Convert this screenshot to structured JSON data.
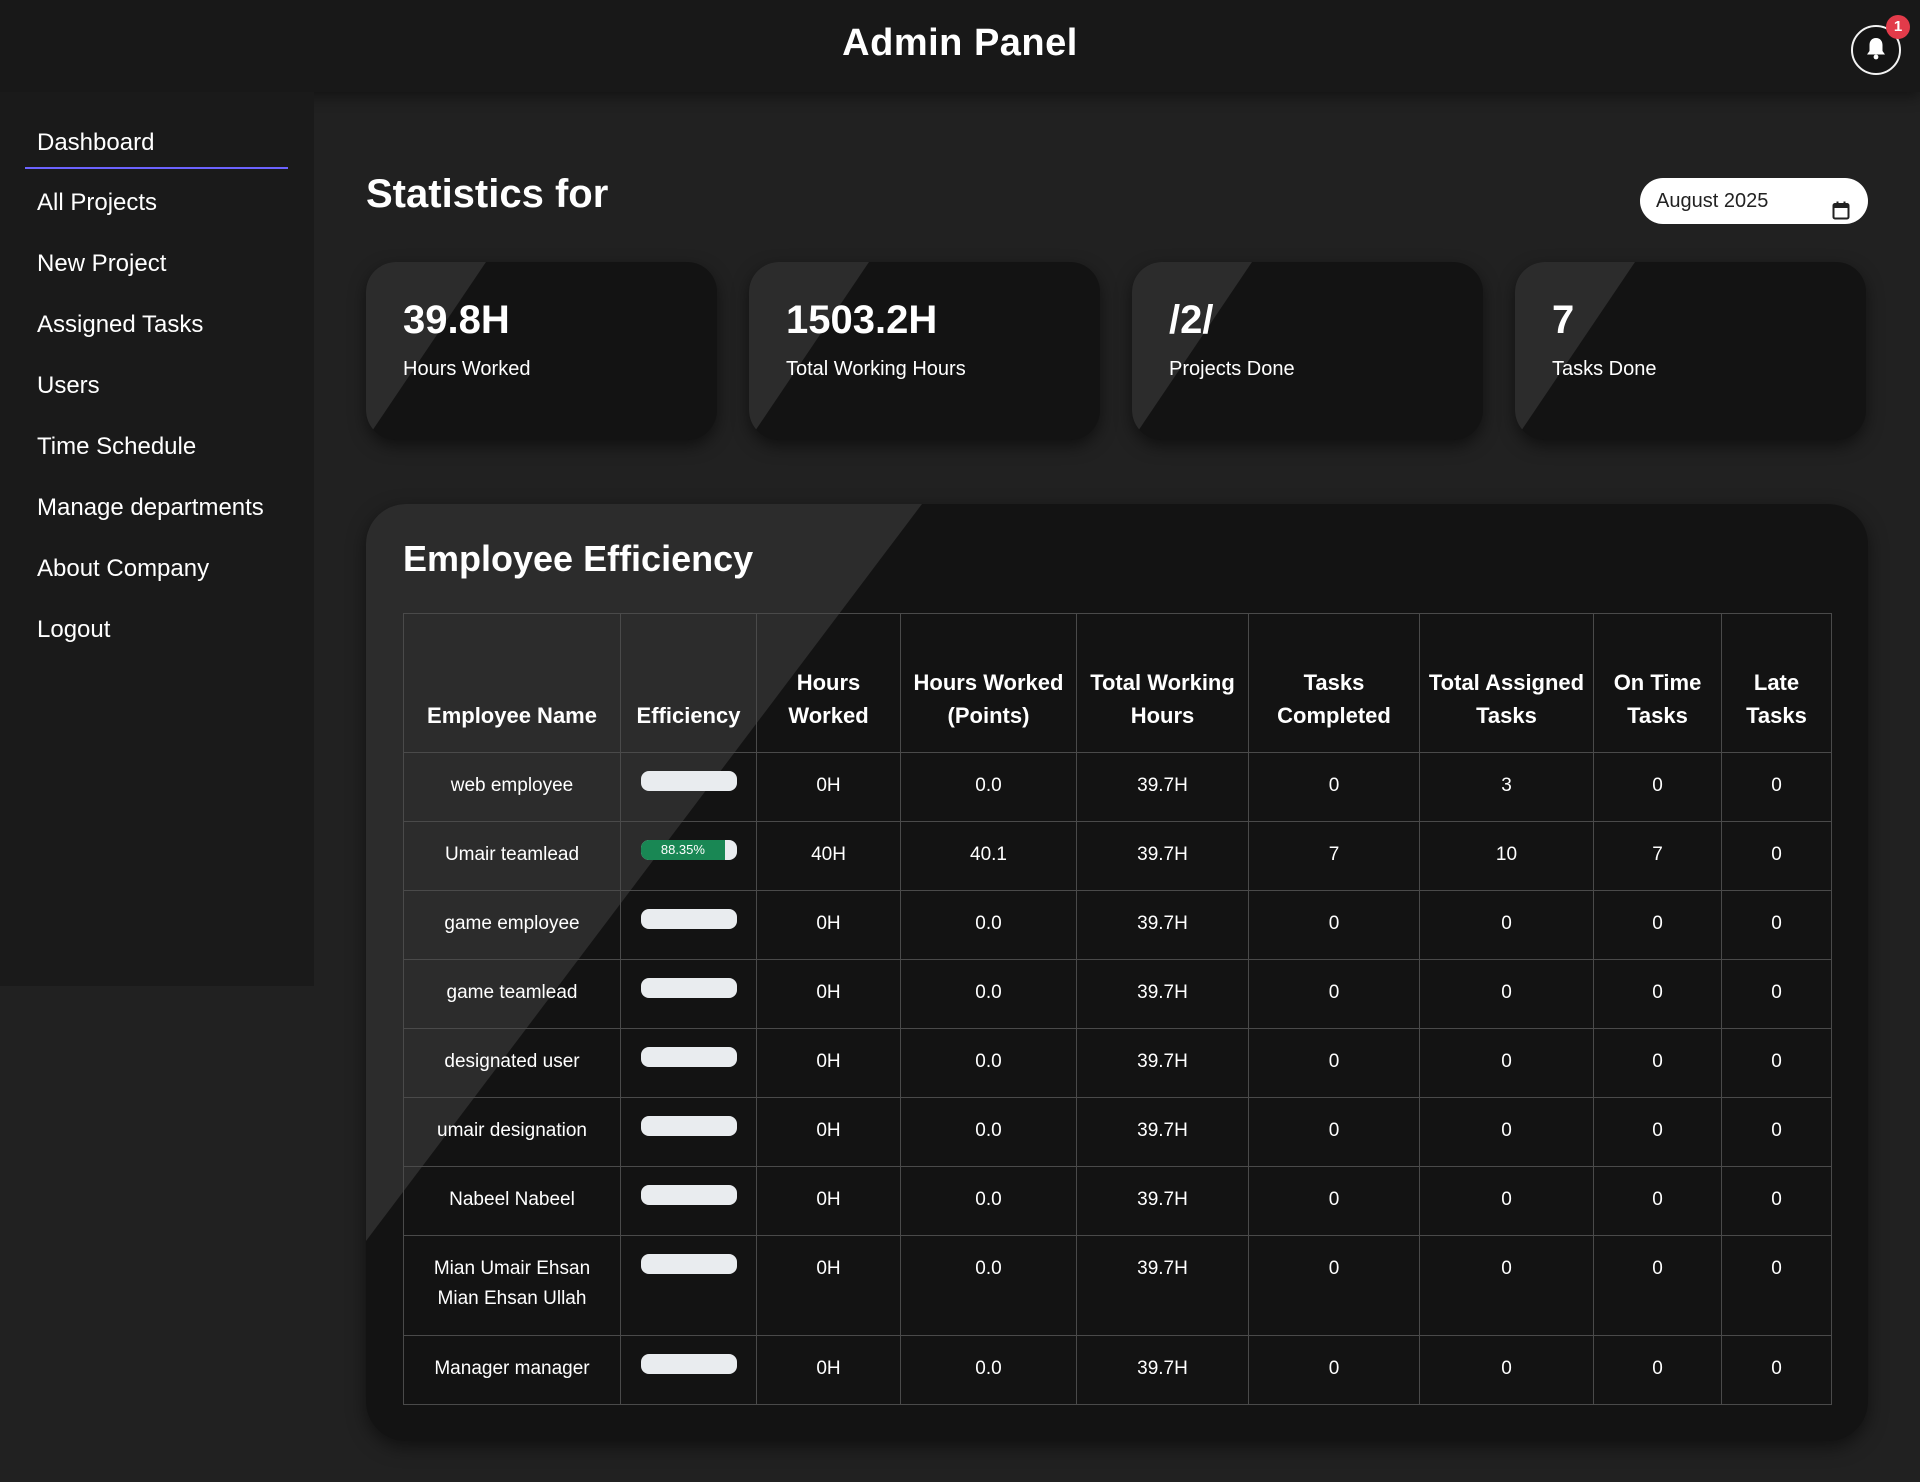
{
  "header": {
    "title": "Admin Panel",
    "notification_count": "1",
    "bell_icon": "bell-icon"
  },
  "sidebar": {
    "items": [
      {
        "label": "Dashboard",
        "active": true
      },
      {
        "label": "All Projects"
      },
      {
        "label": "New Project"
      },
      {
        "label": "Assigned Tasks"
      },
      {
        "label": "Users"
      },
      {
        "label": "Time Schedule"
      },
      {
        "label": "Manage departments"
      },
      {
        "label": "About Company"
      },
      {
        "label": "Logout"
      }
    ],
    "active_underline_color": "#6c63ff"
  },
  "main": {
    "title": "Statistics for",
    "month_value": "August 2025",
    "calendar_icon": "calendar-icon"
  },
  "stats": [
    {
      "value": "39.8H",
      "label": "Hours Worked"
    },
    {
      "value": "1503.2H",
      "label": "Total Working Hours"
    },
    {
      "value": "/2/",
      "label": "Projects Done"
    },
    {
      "value": "7",
      "label": "Tasks Done"
    }
  ],
  "efficiency": {
    "title": "Employee Efficiency",
    "columns": [
      "Employee Name",
      "Efficiency",
      "Hours Worked",
      "Hours Worked (Points)",
      "Total Working Hours",
      "Tasks Completed",
      "Total Assigned Tasks",
      "On Time Tasks",
      "Late Tasks"
    ],
    "bar_color": "#198754",
    "rows": [
      {
        "name": "web employee",
        "efficiency": 0,
        "efficiency_label": "",
        "hours": "0H",
        "points": "0.0",
        "total": "39.7H",
        "completed": "0",
        "assigned": "3",
        "ontime": "0",
        "late": "0"
      },
      {
        "name": "Umair teamlead",
        "efficiency": 88.35,
        "efficiency_label": "88.35%",
        "hours": "40H",
        "points": "40.1",
        "total": "39.7H",
        "completed": "7",
        "assigned": "10",
        "ontime": "7",
        "late": "0"
      },
      {
        "name": "game employee",
        "efficiency": 0,
        "efficiency_label": "",
        "hours": "0H",
        "points": "0.0",
        "total": "39.7H",
        "completed": "0",
        "assigned": "0",
        "ontime": "0",
        "late": "0"
      },
      {
        "name": "game teamlead",
        "efficiency": 0,
        "efficiency_label": "",
        "hours": "0H",
        "points": "0.0",
        "total": "39.7H",
        "completed": "0",
        "assigned": "0",
        "ontime": "0",
        "late": "0"
      },
      {
        "name": "designated user",
        "efficiency": 0,
        "efficiency_label": "",
        "hours": "0H",
        "points": "0.0",
        "total": "39.7H",
        "completed": "0",
        "assigned": "0",
        "ontime": "0",
        "late": "0"
      },
      {
        "name": "umair designation",
        "efficiency": 0,
        "efficiency_label": "",
        "hours": "0H",
        "points": "0.0",
        "total": "39.7H",
        "completed": "0",
        "assigned": "0",
        "ontime": "0",
        "late": "0"
      },
      {
        "name": "Nabeel Nabeel",
        "efficiency": 0,
        "efficiency_label": "",
        "hours": "0H",
        "points": "0.0",
        "total": "39.7H",
        "completed": "0",
        "assigned": "0",
        "ontime": "0",
        "late": "0"
      },
      {
        "name": "Mian Umair Ehsan Mian Ehsan Ullah",
        "efficiency": 0,
        "efficiency_label": "",
        "hours": "0H",
        "points": "0.0",
        "total": "39.7H",
        "completed": "0",
        "assigned": "0",
        "ontime": "0",
        "late": "0"
      },
      {
        "name": "Manager manager",
        "efficiency": 0,
        "efficiency_label": "",
        "hours": "0H",
        "points": "0.0",
        "total": "39.7H",
        "completed": "0",
        "assigned": "0",
        "ontime": "0",
        "late": "0"
      }
    ]
  }
}
